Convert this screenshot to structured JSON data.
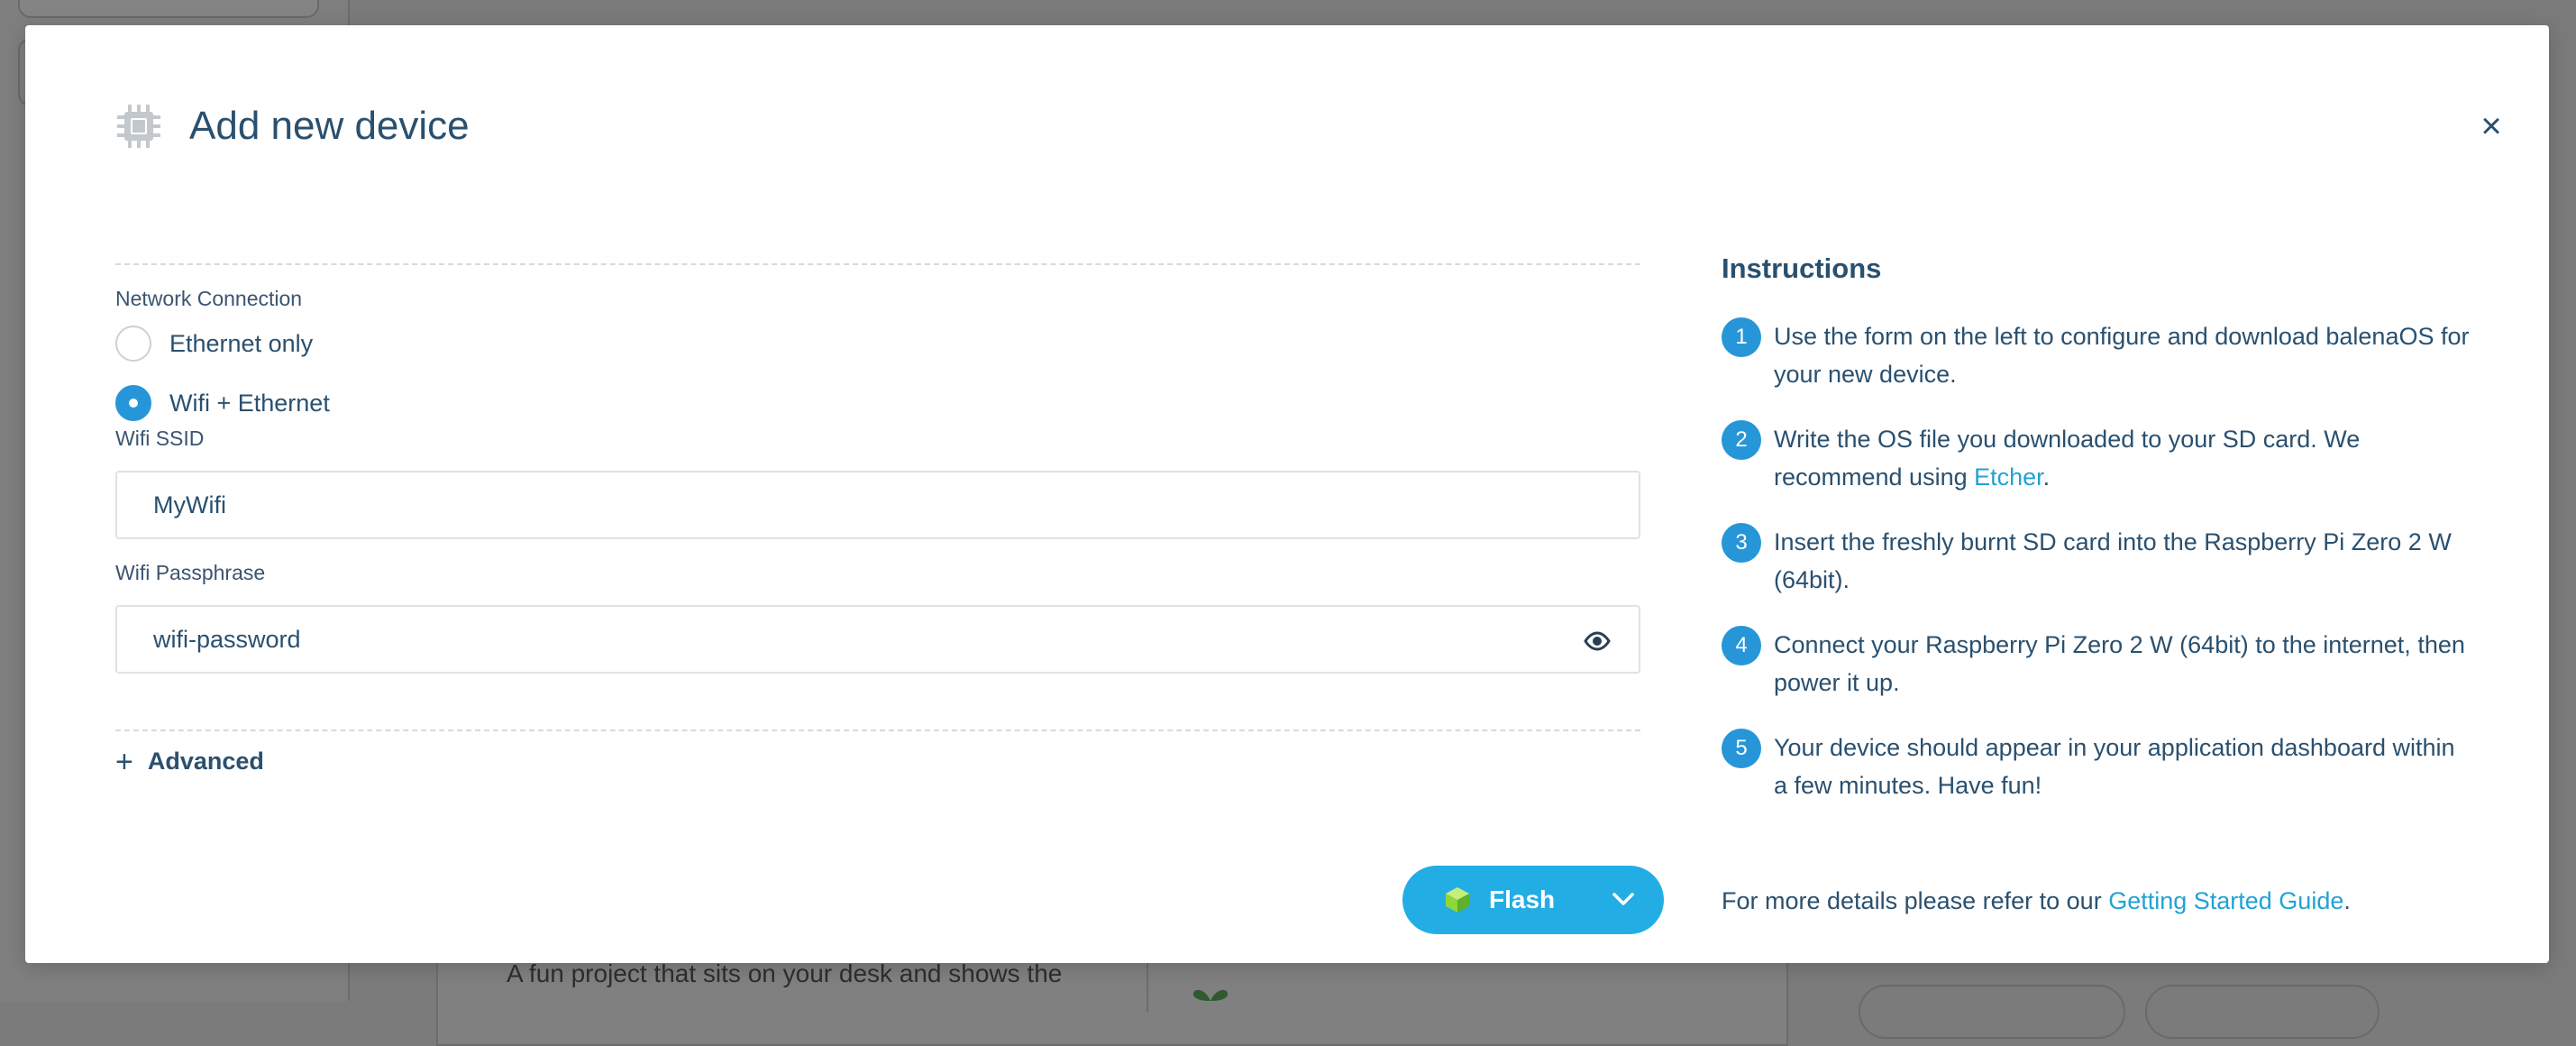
{
  "background": {
    "card_text": "A fun project that sits on your desk and shows the"
  },
  "modal": {
    "title": "Add new device",
    "close_label": "×",
    "network": {
      "label": "Network Connection",
      "options": [
        {
          "label": "Ethernet only",
          "selected": false
        },
        {
          "label": "Wifi + Ethernet",
          "selected": true
        }
      ]
    },
    "wifi_ssid": {
      "label": "Wifi SSID",
      "value": "MyWifi"
    },
    "wifi_passphrase": {
      "label": "Wifi Passphrase",
      "value": "wifi-password"
    },
    "advanced": {
      "icon": "+",
      "label": "Advanced"
    },
    "flash_button": {
      "label": "Flash",
      "color": "#22aee4"
    },
    "instructions": {
      "title": "Instructions",
      "steps": [
        {
          "num": "1",
          "text": "Use the form on the left to configure and download balenaOS for your new device."
        },
        {
          "num": "2",
          "text_before": "Write the OS file you downloaded to your SD card. We recommend using ",
          "link": "Etcher",
          "text_after": "."
        },
        {
          "num": "3",
          "text": "Insert the freshly burnt SD card into the Raspberry Pi Zero 2 W (64bit)."
        },
        {
          "num": "4",
          "text": "Connect your Raspberry Pi Zero 2 W (64bit) to the internet, then power it up."
        },
        {
          "num": "5",
          "text": "Your device should appear in your application dashboard within a few minutes. Have fun!"
        }
      ],
      "footer_before": "For more details please refer to our ",
      "footer_link": "Getting Started Guide",
      "footer_after": "."
    }
  },
  "colors": {
    "accent": "#2796d8",
    "link": "#22a2d4",
    "text": "#2a506f"
  }
}
